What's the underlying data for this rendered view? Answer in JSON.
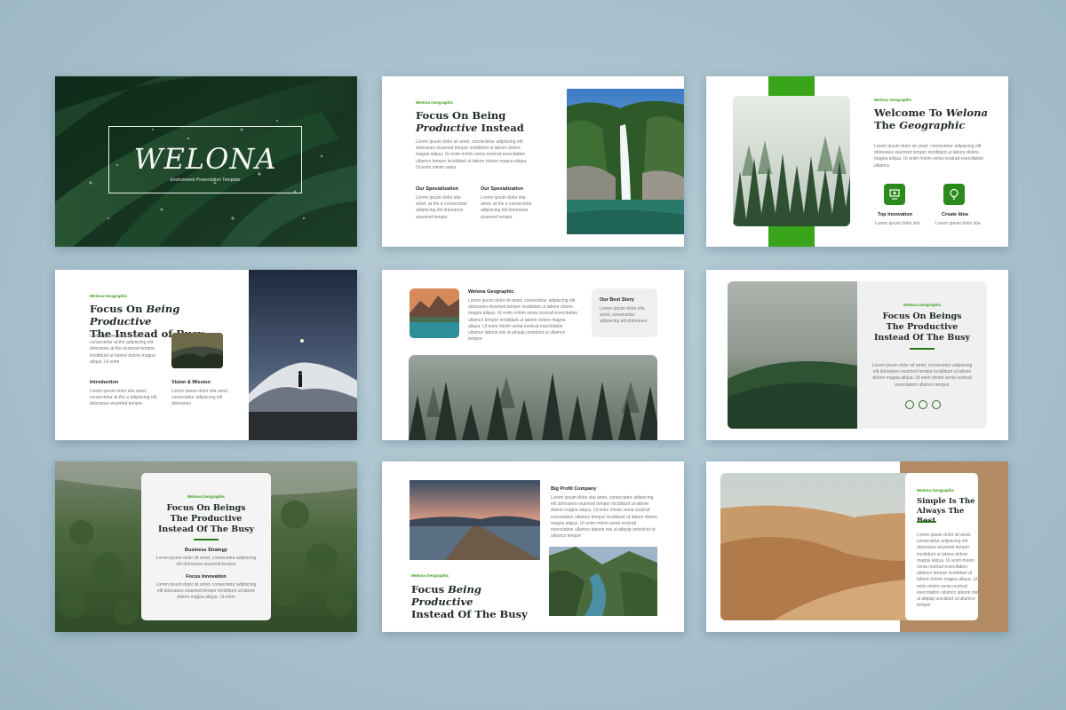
{
  "slide1": {
    "brand": "WELONA",
    "tagline": "Environment Presentation Template"
  },
  "slide2": {
    "kicker": "Welona Geographic",
    "title_a": "Focus On Being",
    "title_b_italic": "Productive",
    "title_b_rest": " Instead",
    "body": "Lorem ipsum dolor sit amet, consectetur adipiscing elit doloranes eiusmod tempor incididunt ut labore dolore magna aliqua. Ut enim minim venia nostrud exercitation ullamco tempor incididunt ut labore dolore magna aliqua. Ut enim minim venia",
    "col1_title": "Our Spesialization",
    "col1_body": "Lorem ipsum dolor sita amet, at the a consectetur adipiscing elit doloranes eiusmod tempor",
    "col2_title": "Our Spesialization",
    "col2_body": "Lorem ipsum dolor sita amet, at the a consectetur adipiscing elit doloranes eiusmod tempor"
  },
  "slide3": {
    "kicker": "Welona Geographic",
    "title_a": "Welcome To ",
    "title_a_italic": "Welona",
    "title_b": "The ",
    "title_b_italic": "Geographic",
    "body": "Lorem ipsum dolor sit amet, consectetur adipiscing elit doloranes eiusmod tempor incididunt ut labore dolore magna aliqua. Ut enim minim venia nostrud exercitation ullamco",
    "f1_title": "Top Innovation",
    "f1_body": "Lorem ipsum dolor sita",
    "f2_title": "Create Idea",
    "f2_body": "Lorem ipsum dolor sita"
  },
  "slide4": {
    "kicker": "Welona Geographic",
    "title_a": "Focus On ",
    "title_a_italic": "Being Productive",
    "title_b": "The Instead of Busy",
    "body": "Lorem ipsum dolor sit amet, consectetur at the adipiscing elit doloranes at the eiusmod tempor incididunt ut labore dolore magna aliqua. Ut enim",
    "c1_title": "Introduction",
    "c1_body": "Lorem ipsum dolor sita amet, consectetur at the a adipiscing elit doloranes eiusmod tempor",
    "c2_title": "Vision & Mission",
    "c2_body": "Lorem ipsum dolor sita amet, consectetur adipiscing elit doloranes"
  },
  "slide5": {
    "title": "Welona Geographic",
    "body": "Lorem ipsum dolor sit amet, consectetur adipiscing elit doloranes eiusmod tempor incididunt ut labore dolore magna aliqua. Ut enim minim venia nostrud exercitation ullamco tempor incididunt ut labore dolore magna aliqua. Ut enim minim venia nostrud exercitation ullamco laboris nisi ut aliquip unicidunt ut ullamco tempor",
    "story_title": "Our Best Story",
    "story_body": "Lorem ipsum dolor sita amet, consectetur adipiscing elit doloranes"
  },
  "slide6": {
    "kicker": "Welona Geographic",
    "title": "Focus On Beings The Productive Instead Of The Busy",
    "body": "Lorem ipsum dolor sit amet, consectetur adipiscing elit doloranes eiusmod tempor incididunt ut labore dolore magna aliqua. Ut enim minim venia nostrud exercitation ullamco tempor"
  },
  "slide7": {
    "kicker": "Welona Geographic",
    "title": "Focus On Beings The Productive Instead Of The Busy",
    "s1_title": "Business Strategy",
    "s1_body": "Lorem ipsum dolor sit amet, consectetur adipiscing elit doloranes eiusmod tempor",
    "s2_title": "Focus Innovation",
    "s2_body": "Lorem ipsum dolor sit amet, consectetur adipiscing elit doloranes eiusmod tempor incididunt ut labore dolore magna aliqua. Ut enim"
  },
  "slide8": {
    "company": "Big Profit Company",
    "body": "Lorem ipsum dolor sita amet, consectetur adipiscing elit doloranes eiusmod tempor incididunt ut labore dolore magna aliqua. Ut enim minim venia nostrud exercitation ullamco tempor incididunt ut labore dolore magna aliqua. Ut enim minim venia nostrud exercitation ullamco laboris nisi ut aliquip unicidunt ut ullamco tempor",
    "kicker": "Welona Geographic",
    "title_a": "Focus ",
    "title_a_italic": "Being Productive",
    "title_b": "Instead Of The Busy"
  },
  "slide9": {
    "kicker": "Welona Geographic",
    "title": "Simple Is The Always The Best",
    "body": "Lorem ipsum dolor sit amet, consectetur adipiscing elit doloranes eiusmod tempor incididunt ut labore dolore magna aliqua. Ut enim minim venia nostrud exercitation ullamco tempor incididunt ut labore dolore magna aliqua. Ut enim minim venia nostrud exercitation ullamco laboris nisi ut aliquip unicidunt ut ullamco tempor"
  },
  "colors": {
    "accent": "#3aa51a",
    "dark_green": "#2a8a1c",
    "background": "#a9c2ce"
  }
}
